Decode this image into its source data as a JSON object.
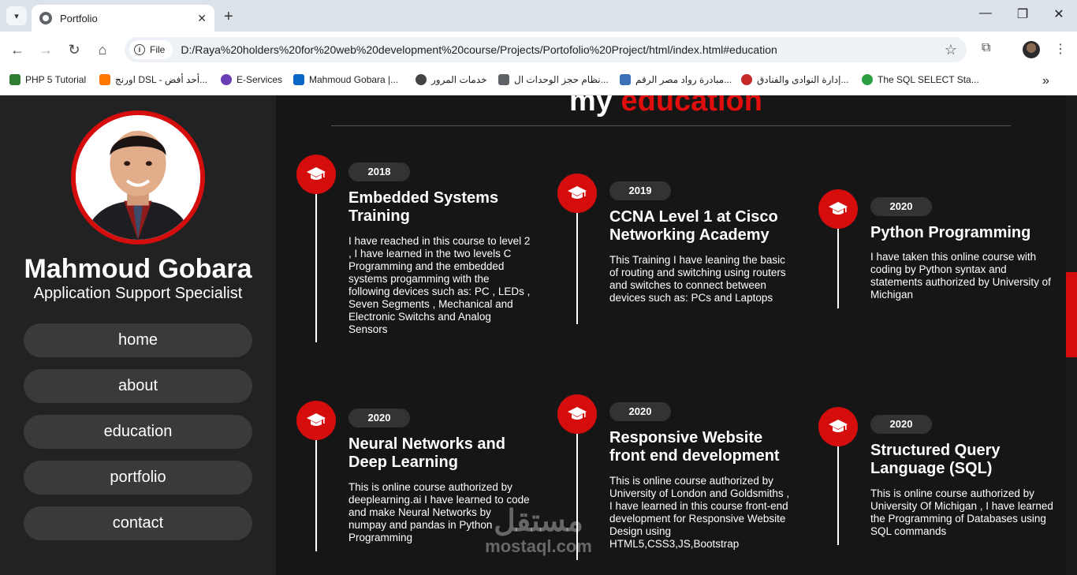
{
  "browser": {
    "tab_title": "Portfolio",
    "url_chip": "File",
    "url": "D:/Raya%20holders%20for%20web%20development%20course/Projects/Portofolio%20Project/html/index.html#education",
    "bookmarks": [
      {
        "label": "PHP 5 Tutorial",
        "color": "#2e7d32"
      },
      {
        "label": "اورنج DSL - أحد أفض...",
        "color": "#ff7900"
      },
      {
        "label": "E-Services",
        "color": "#6a3fb5"
      },
      {
        "label": "Mahmoud Gobara |...",
        "color": "#0a66c2"
      },
      {
        "label": "خدمات المرور",
        "color": "#444444"
      },
      {
        "label": "نظام حجز الوحدات ال...",
        "color": "#5f6368"
      },
      {
        "label": "مبادرة رواد مصر الرقم...",
        "color": "#3b6fb6"
      },
      {
        "label": "إدارة النوادى والفنادق...",
        "color": "#c62828"
      },
      {
        "label": "The SQL SELECT Sta...",
        "color": "#2e9e44"
      }
    ]
  },
  "sidebar": {
    "name": "Mahmoud Gobara",
    "role": "Application Support Specialist",
    "nav": [
      "home",
      "about",
      "education",
      "portfolio",
      "contact"
    ]
  },
  "section": {
    "heading_plain": "my",
    "heading_accent": "education"
  },
  "education": [
    {
      "year": "2018",
      "title": "Embedded Systems Training",
      "desc": "I have reached in this course to level 2 , I have learned in the two levels C Programming and the embedded systems progamming with the following devices such as: PC , LEDs , Seven Segments , Mechanical and Electronic Switchs and Analog Sensors"
    },
    {
      "year": "2019",
      "title": "CCNA Level 1 at Cisco Networking Academy",
      "desc": "This Training I have leaning the basic of routing and switching using routers and switches to connect between devices such as: PCs and Laptops"
    },
    {
      "year": "2020",
      "title": "Python Programming",
      "desc": "I have taken this online course with coding by Python syntax and statements authorized by University of Michigan"
    },
    {
      "year": "2020",
      "title": "Neural Networks and Deep Learning",
      "desc": "This is online course authorized by deeplearning.ai I have learned to code and make Neural Networks by numpay and pandas in Python Programming"
    },
    {
      "year": "2020",
      "title": "Responsive Website front end development",
      "desc": "This is online course authorized by University of London and Goldsmiths , I have learned in this course front-end development for Responsive Website Design using HTML5,CSS3,JS,Bootstrap"
    },
    {
      "year": "2020",
      "title": "Structured Query Language (SQL)",
      "desc": "This is online course authorized by University Of Michigan , I have learned the Programming of Databases using SQL commands"
    }
  ],
  "watermark": {
    "arabic": "مستقل",
    "latin": "mostaql.com"
  },
  "colors": {
    "accent": "#d50d0d",
    "sidebar_bg": "#222222",
    "page_bg": "#161616"
  }
}
